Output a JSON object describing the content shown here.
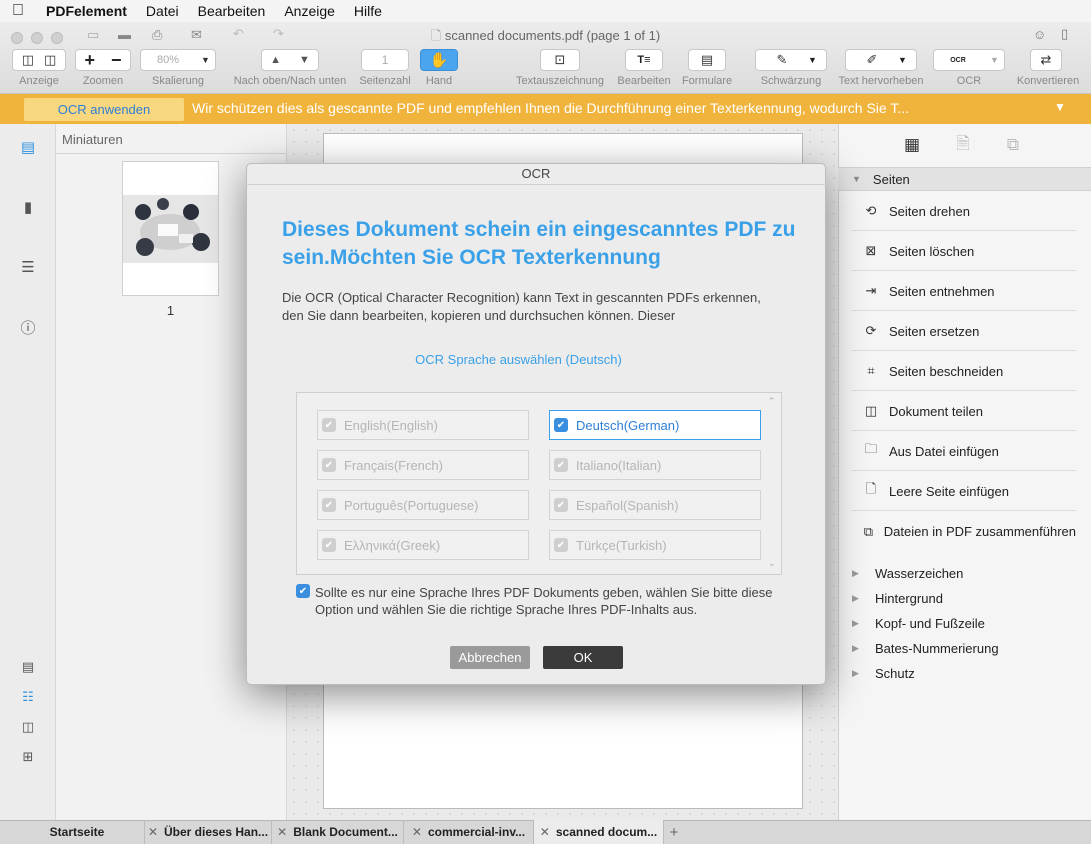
{
  "menubar": {
    "apple": "",
    "app": "PDFelement",
    "items": [
      "Datei",
      "Bearbeiten",
      "Anzeige",
      "Hilfe"
    ]
  },
  "window": {
    "title": "scanned documents.pdf (page 1 of 1)"
  },
  "toolbar": {
    "zoom_value": "80%",
    "page_number": "1",
    "labels": {
      "view": "Anzeige",
      "zoom": "Zoomen",
      "scale": "Skalierung",
      "nav": "Nach oben/Nach unten",
      "page": "Seitenzahl",
      "hand": "Hand",
      "markup": "Textauszeichnung",
      "edit": "Bearbeiten",
      "forms": "Formulare",
      "redact": "Schwärzung",
      "highlight": "Text hervorheben",
      "ocr": "OCR",
      "convert": "Konvertieren"
    },
    "ocr_icon_text": "OCR"
  },
  "banner": {
    "button": "OCR anwenden",
    "text": "Wir schützen dies als gescannte PDF und empfehlen Ihnen die Durchführung einer Texterkennung, wodurch Sie T..."
  },
  "thumbs": {
    "title": "Miniaturen",
    "page": "1"
  },
  "right_panel": {
    "section": "Seiten",
    "items": [
      "Seiten drehen",
      "Seiten löschen",
      "Seiten entnehmen",
      "Seiten ersetzen",
      "Seiten beschneiden",
      "Dokument teilen",
      "Aus Datei einfügen",
      "Leere Seite einfügen",
      "Dateien in PDF zusammenführen"
    ],
    "subsections": [
      "Wasserzeichen",
      "Hintergrund",
      "Kopf- und Fußzeile",
      "Bates-Nummerierung",
      "Schutz"
    ]
  },
  "modal": {
    "title": "OCR",
    "heading": "Dieses Dokument schein ein eingescanntes PDF zu sein.Möchten Sie OCR Texterkennung",
    "description": "Die OCR (Optical Character Recognition) kann Text in gescannten PDFs erkennen, den Sie dann bearbeiten, kopieren und durchsuchen können. Dieser",
    "language_select": "OCR Sprache auswählen (Deutsch)",
    "languages": [
      "English(English)",
      "Deutsch(German)",
      "Français(French)",
      "Italiano(Italian)",
      "Português(Portuguese)",
      "Español(Spanish)",
      "Ελληνικά(Greek)",
      "Türkçe(Turkish)"
    ],
    "selected_language": "Deutsch(German)",
    "single_language_option": "Sollte es nur eine Sprache Ihres PDF Dokuments geben, wählen Sie bitte diese Option und wählen Sie die richtige Sprache Ihres PDF-Inhalts aus.",
    "single_language_checked": true,
    "cancel": "Abbrechen",
    "ok": "OK"
  },
  "tabs": [
    "Startseite",
    "Über dieses Han...",
    "Blank Document...",
    "commercial-inv...",
    "scanned docum..."
  ],
  "active_tab": "scanned docum...",
  "colors": {
    "accent": "#3aa1e8",
    "banner": "#f0b43d"
  }
}
